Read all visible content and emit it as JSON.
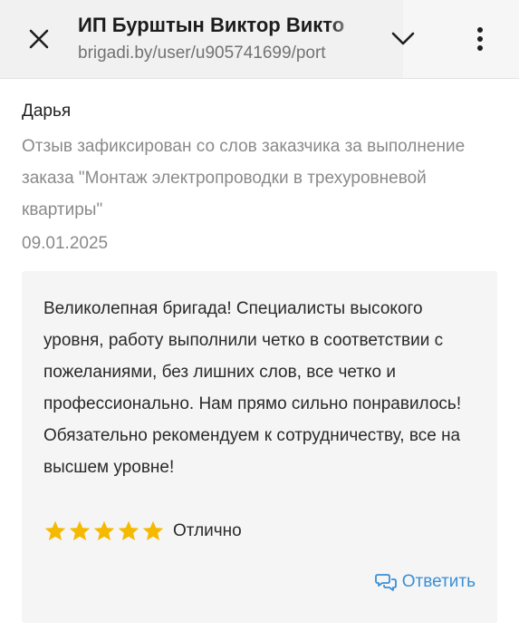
{
  "header": {
    "title": "ИП Бурштын Виктор Викто",
    "url": "brigadi.by/user/u905741699/port",
    "close_icon": "close-icon",
    "chevron_icon": "chevron-down-icon",
    "more_icon": "more-vertical-icon"
  },
  "review": {
    "reviewer_name": "Дарья",
    "note": "Отзыв зафиксирован со слов заказчика за выполнение заказа \"Монтаж электропроводки в трехуровневой квартиры\"",
    "date": "09.01.2025",
    "text": "Великолепная бригада! Специалисты высокого уровня, работу выполнили четко в соответствии с пожеланиями, без лишних слов, все четко и профессионально. Нам прямо сильно понравилось! Обязательно рекомендуем к сотрудничеству, все на высшем уровне!",
    "rating": 5,
    "rating_max": 5,
    "rating_label": "Отлично",
    "reply_label": "Ответить",
    "reply_icon": "chat-bubbles-icon"
  },
  "colors": {
    "star": "#f5b900",
    "link": "#3a8fd6",
    "muted_text": "#8a8a8a",
    "card_bg": "#f5f5f5"
  }
}
